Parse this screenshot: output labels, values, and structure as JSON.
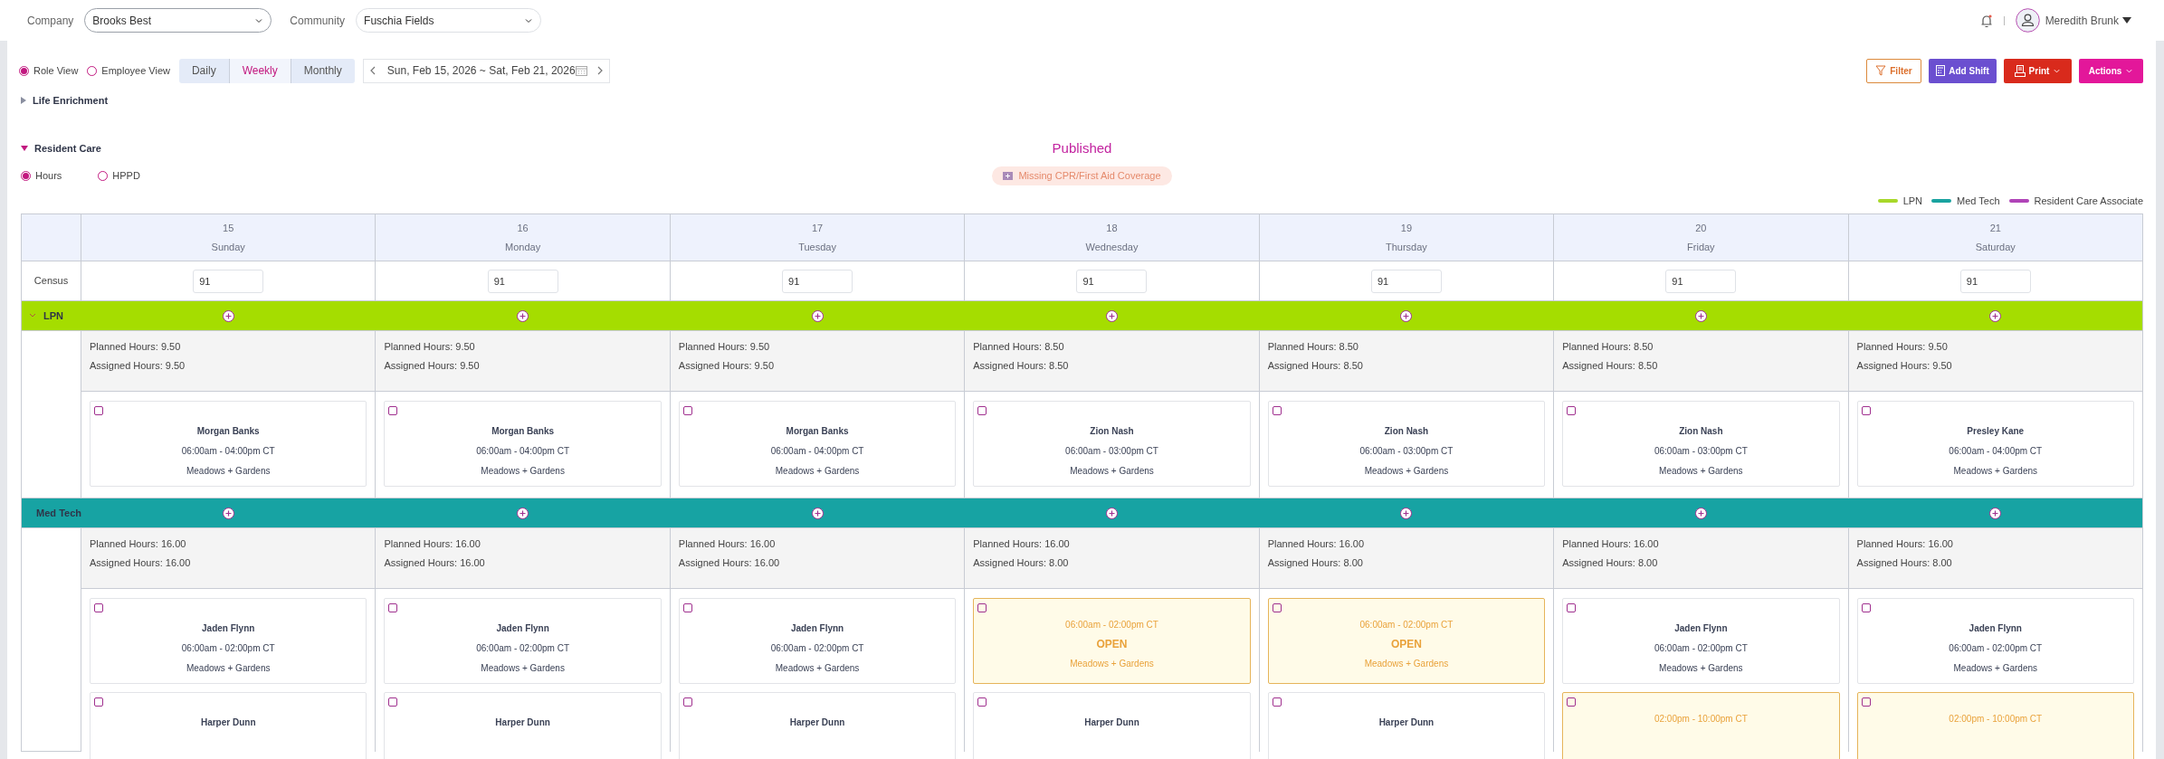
{
  "header": {
    "company_label": "Company",
    "company": "Brooks Best",
    "community_label": "Community",
    "community": "Fuschia Fields",
    "user": "Meredith Brunk"
  },
  "views": [
    {
      "label": "Role View",
      "selected": true
    },
    {
      "label": "Employee View",
      "selected": false
    }
  ],
  "periods": [
    {
      "label": "Daily",
      "selected": false
    },
    {
      "label": "Weekly",
      "selected": true
    },
    {
      "label": "Monthly",
      "selected": false
    }
  ],
  "date_range": "Sun, Feb 15, 2026 ~ Sat, Feb 21, 2026",
  "actions": [
    {
      "kind": "filter",
      "label": "Filter"
    },
    {
      "kind": "add",
      "label": "Add Shift"
    },
    {
      "kind": "print",
      "label": "Print"
    },
    {
      "kind": "actions",
      "label": "Actions"
    }
  ],
  "sections": [
    {
      "title": "Life Enrichment",
      "expanded": false
    },
    {
      "title": "Resident Care",
      "expanded": true
    }
  ],
  "status": "Published",
  "metrics": [
    {
      "label": "Hours",
      "selected": true
    },
    {
      "label": "HPPD",
      "selected": false
    }
  ],
  "alert": "Missing CPR/First Aid Coverage",
  "legend": [
    {
      "label": "LPN",
      "color": "#a8d82a"
    },
    {
      "label": "Med Tech",
      "color": "#1aa3a0"
    },
    {
      "label": "Resident Care Associate",
      "color": "#b044b8"
    }
  ],
  "census_label": "Census",
  "days": [
    {
      "date": "15",
      "weekday": "Sunday",
      "census": "91"
    },
    {
      "date": "16",
      "weekday": "Monday",
      "census": "91"
    },
    {
      "date": "17",
      "weekday": "Tuesday",
      "census": "91"
    },
    {
      "date": "18",
      "weekday": "Wednesday",
      "census": "91"
    },
    {
      "date": "19",
      "weekday": "Thursday",
      "census": "91"
    },
    {
      "date": "20",
      "weekday": "Friday",
      "census": "91"
    },
    {
      "date": "21",
      "weekday": "Saturday",
      "census": "91"
    }
  ],
  "roles": [
    {
      "name": "LPN",
      "color": "#a5dd00",
      "expanded": true,
      "days": [
        {
          "planned": "Planned Hours: 9.50",
          "assigned": "Assigned Hours: 9.50",
          "shifts": [
            {
              "kind": "assigned",
              "checked": false,
              "name": "Morgan Banks",
              "time": "06:00am - 04:00pm CT",
              "location": "Meadows + Gardens"
            }
          ]
        },
        {
          "planned": "Planned Hours: 9.50",
          "assigned": "Assigned Hours: 9.50",
          "shifts": [
            {
              "kind": "assigned",
              "checked": false,
              "name": "Morgan Banks",
              "time": "06:00am - 04:00pm CT",
              "location": "Meadows + Gardens"
            }
          ]
        },
        {
          "planned": "Planned Hours: 9.50",
          "assigned": "Assigned Hours: 9.50",
          "shifts": [
            {
              "kind": "assigned",
              "checked": false,
              "name": "Morgan Banks",
              "time": "06:00am - 04:00pm CT",
              "location": "Meadows + Gardens"
            }
          ]
        },
        {
          "planned": "Planned Hours: 8.50",
          "assigned": "Assigned Hours: 8.50",
          "shifts": [
            {
              "kind": "assigned",
              "checked": false,
              "name": "Zion Nash",
              "time": "06:00am - 03:00pm CT",
              "location": "Meadows + Gardens"
            }
          ]
        },
        {
          "planned": "Planned Hours: 8.50",
          "assigned": "Assigned Hours: 8.50",
          "shifts": [
            {
              "kind": "assigned",
              "checked": false,
              "name": "Zion Nash",
              "time": "06:00am - 03:00pm CT",
              "location": "Meadows + Gardens"
            }
          ]
        },
        {
          "planned": "Planned Hours: 8.50",
          "assigned": "Assigned Hours: 8.50",
          "shifts": [
            {
              "kind": "assigned",
              "checked": false,
              "name": "Zion Nash",
              "time": "06:00am - 03:00pm CT",
              "location": "Meadows + Gardens"
            }
          ]
        },
        {
          "planned": "Planned Hours: 9.50",
          "assigned": "Assigned Hours: 9.50",
          "shifts": [
            {
              "kind": "assigned",
              "checked": false,
              "name": "Presley Kane",
              "time": "06:00am - 04:00pm CT",
              "location": "Meadows + Gardens"
            }
          ]
        }
      ]
    },
    {
      "name": "Med Tech",
      "color": "#17a3a3",
      "expanded": true,
      "days": [
        {
          "planned": "Planned Hours: 16.00",
          "assigned": "Assigned Hours: 16.00",
          "shifts": [
            {
              "kind": "assigned",
              "checked": false,
              "name": "Jaden Flynn",
              "time": "06:00am - 02:00pm CT",
              "location": "Meadows + Gardens"
            },
            {
              "kind": "assigned",
              "checked": false,
              "name": "Harper Dunn"
            }
          ]
        },
        {
          "planned": "Planned Hours: 16.00",
          "assigned": "Assigned Hours: 16.00",
          "shifts": [
            {
              "kind": "assigned",
              "checked": false,
              "name": "Jaden Flynn",
              "time": "06:00am - 02:00pm CT",
              "location": "Meadows + Gardens"
            },
            {
              "kind": "assigned",
              "checked": false,
              "name": "Harper Dunn"
            }
          ]
        },
        {
          "planned": "Planned Hours: 16.00",
          "assigned": "Assigned Hours: 16.00",
          "shifts": [
            {
              "kind": "assigned",
              "checked": false,
              "name": "Jaden Flynn",
              "time": "06:00am - 02:00pm CT",
              "location": "Meadows + Gardens"
            },
            {
              "kind": "assigned",
              "checked": false,
              "name": "Harper Dunn"
            }
          ]
        },
        {
          "planned": "Planned Hours: 16.00",
          "assigned": "Assigned Hours: 8.00",
          "shifts": [
            {
              "kind": "open",
              "checked": false,
              "time": "06:00am - 02:00pm CT",
              "status": "OPEN",
              "location": "Meadows + Gardens"
            },
            {
              "kind": "assigned",
              "checked": false,
              "name": "Harper Dunn"
            }
          ]
        },
        {
          "planned": "Planned Hours: 16.00",
          "assigned": "Assigned Hours: 8.00",
          "shifts": [
            {
              "kind": "open",
              "checked": false,
              "time": "06:00am - 02:00pm CT",
              "status": "OPEN",
              "location": "Meadows + Gardens"
            },
            {
              "kind": "assigned",
              "checked": false,
              "name": "Harper Dunn"
            }
          ]
        },
        {
          "planned": "Planned Hours: 16.00",
          "assigned": "Assigned Hours: 8.00",
          "shifts": [
            {
              "kind": "assigned",
              "checked": false,
              "name": "Jaden Flynn",
              "time": "06:00am - 02:00pm CT",
              "location": "Meadows + Gardens"
            },
            {
              "kind": "open",
              "checked": false,
              "time": "02:00pm - 10:00pm CT"
            }
          ]
        },
        {
          "planned": "Planned Hours: 16.00",
          "assigned": "Assigned Hours: 8.00",
          "shifts": [
            {
              "kind": "assigned",
              "checked": false,
              "name": "Jaden Flynn",
              "time": "06:00am - 02:00pm CT",
              "location": "Meadows + Gardens"
            },
            {
              "kind": "open",
              "checked": false,
              "time": "02:00pm - 10:00pm CT"
            }
          ]
        }
      ]
    }
  ]
}
